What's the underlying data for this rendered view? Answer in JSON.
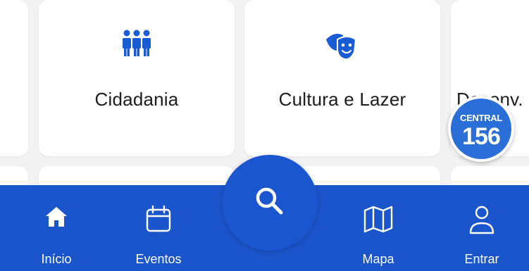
{
  "services": [
    {
      "label": "Cidadania",
      "icon": "people-group-icon"
    },
    {
      "label": "Cultura e Lazer",
      "icon": "theater-masks-icon"
    },
    {
      "label": "Desenv.",
      "icon": "none"
    }
  ],
  "badge": {
    "top": "CENTRAL",
    "number": "156"
  },
  "nav": {
    "inicio": "Início",
    "eventos": "Eventos",
    "mapa": "Mapa",
    "entrar": "Entrar"
  },
  "colors": {
    "primary": "#1b55cc",
    "icon_blue": "#1a5bd6",
    "badge": "#2a6fd8",
    "background": "#f2f2f4"
  }
}
